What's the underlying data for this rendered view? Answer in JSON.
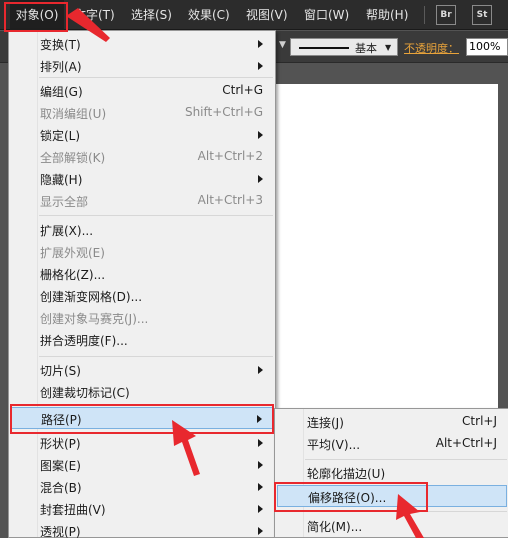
{
  "menubar": {
    "items": [
      "对象(O)",
      "文字(T)",
      "选择(S)",
      "效果(C)",
      "视图(V)",
      "窗口(W)",
      "帮助(H)"
    ],
    "apps": [
      "Br",
      "St"
    ]
  },
  "controlbar": {
    "stroke_label": "基本",
    "opacity_label": "不透明度：",
    "opacity_value": "100%"
  },
  "object_menu": {
    "items": [
      {
        "label": "变换(T)",
        "submenu": true
      },
      {
        "label": "排列(A)",
        "submenu": true
      },
      {
        "label": "编组(G)",
        "shortcut": "Ctrl+G"
      },
      {
        "label": "取消编组(U)",
        "shortcut": "Shift+Ctrl+G",
        "disabled": true
      },
      {
        "label": "锁定(L)",
        "submenu": true
      },
      {
        "label": "全部解锁(K)",
        "shortcut": "Alt+Ctrl+2",
        "disabled": true
      },
      {
        "label": "隐藏(H)",
        "submenu": true
      },
      {
        "label": "显示全部",
        "shortcut": "Alt+Ctrl+3",
        "disabled": true
      },
      {
        "label": "扩展(X)..."
      },
      {
        "label": "扩展外观(E)",
        "disabled": true
      },
      {
        "label": "栅格化(Z)..."
      },
      {
        "label": "创建渐变网格(D)..."
      },
      {
        "label": "创建对象马赛克(J)...",
        "disabled": true
      },
      {
        "label": "拼合透明度(F)..."
      },
      {
        "label": "切片(S)",
        "submenu": true
      },
      {
        "label": "创建裁切标记(C)"
      },
      {
        "label": "路径(P)",
        "submenu": true,
        "highlighted": true
      },
      {
        "label": "形状(P)",
        "submenu": true
      },
      {
        "label": "图案(E)",
        "submenu": true
      },
      {
        "label": "混合(B)",
        "submenu": true
      },
      {
        "label": "封套扭曲(V)",
        "submenu": true
      },
      {
        "label": "透视(P)",
        "submenu": true
      }
    ]
  },
  "path_submenu": {
    "items": [
      {
        "label": "连接(J)",
        "shortcut": "Ctrl+J"
      },
      {
        "label": "平均(V)...",
        "shortcut": "Alt+Ctrl+J"
      },
      {
        "label": "轮廓化描边(U)"
      },
      {
        "label": "偏移路径(O)...",
        "highlighted": true
      },
      {
        "label": "简化(M)..."
      }
    ]
  },
  "colors": {
    "annotation_red": "#e8282e",
    "highlight_bg": "#cfe4f7",
    "opacity_label": "#e8a33a"
  }
}
